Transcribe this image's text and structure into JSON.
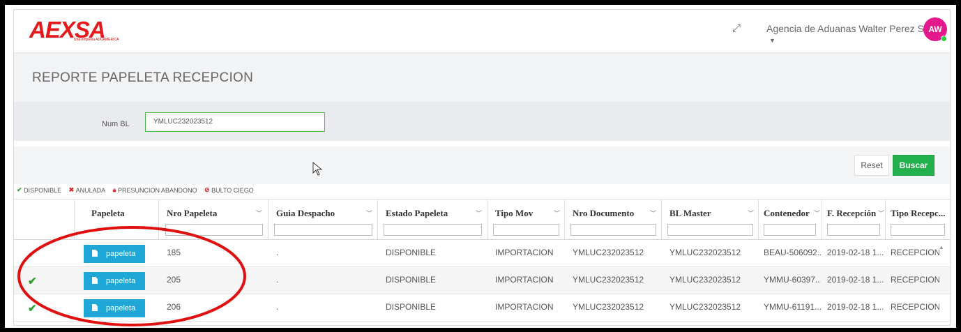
{
  "header": {
    "logo_text": "AEXSA",
    "logo_sub": "Una empresa ADUAMERICA",
    "agency_name": "Agencia de Aduanas Walter Perez Salas",
    "avatar_initials": "AW"
  },
  "page": {
    "title": "REPORTE PAPELETA RECEPCION"
  },
  "filter": {
    "label": "Num BL",
    "value": "YMLUC232023512"
  },
  "actions": {
    "reset_label": "Reset",
    "buscar_label": "Buscar"
  },
  "legend": {
    "disponible": "DISPONIBLE",
    "anulada": "ANULADA",
    "presuncion": "PRESUNCION ABANDONO",
    "bulto": "BULTO CIEGO"
  },
  "table": {
    "columns": [
      "Papeleta",
      "Nro Papeleta",
      "Guia Despacho",
      "Estado Papeleta",
      "Tipo Mov",
      "Nro Documento",
      "BL Master",
      "Contenedor",
      "F. Recepción",
      "Tipo Recepc..."
    ],
    "button_label": "papeleta",
    "rows": [
      {
        "nro": "185",
        "guia": ".",
        "estado": "DISPONIBLE",
        "tipo": "IMPORTACION",
        "doc": "YMLUC232023512",
        "bl": "YMLUC232023512",
        "cont": "BEAU-506092...",
        "fecha": "2019-02-18 1...",
        "recep": "RECEPCION"
      },
      {
        "nro": "205",
        "guia": ".",
        "estado": "DISPONIBLE",
        "tipo": "IMPORTACION",
        "doc": "YMLUC232023512",
        "bl": "YMLUC232023512",
        "cont": "YMMU-60397...",
        "fecha": "2019-02-18 1...",
        "recep": "RECEPCION"
      },
      {
        "nro": "206",
        "guia": ".",
        "estado": "DISPONIBLE",
        "tipo": "IMPORTACION",
        "doc": "YMLUC232023512",
        "bl": "YMLUC232023512",
        "cont": "YMMU-61191...",
        "fecha": "2019-02-18 1...",
        "recep": "RECEPCION"
      }
    ]
  },
  "colors": {
    "accent_green": "#22b14c",
    "papeleta_blue": "#1fa8d7",
    "logo_red": "#e3191b",
    "avatar_pink": "#e6198c",
    "annotation_red": "#e01010"
  }
}
